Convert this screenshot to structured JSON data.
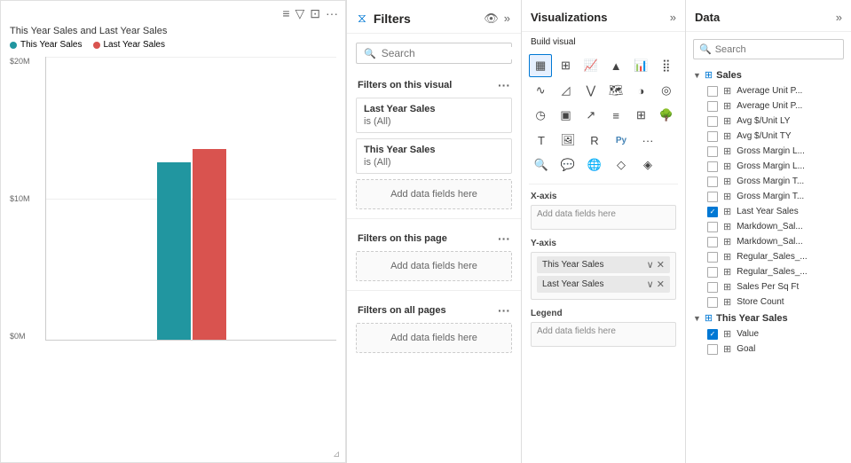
{
  "chart": {
    "title": "This Year Sales and Last Year Sales",
    "legend": [
      {
        "label": "This Year Sales",
        "color": "#2196A0"
      },
      {
        "label": "Last Year Sales",
        "color": "#d9534f"
      }
    ],
    "y_axis": [
      "$20M",
      "$10M",
      "$0M"
    ],
    "bar_this_year_height": 200,
    "bar_last_year_height": 215
  },
  "filters": {
    "title": "Filters",
    "search_placeholder": "Search",
    "filters_on_visual_label": "Filters on this visual",
    "filters_on_page_label": "Filters on this page",
    "filters_on_all_label": "Filters on all pages",
    "visual_filters": [
      {
        "title": "Last Year Sales",
        "sub": "is (All)"
      },
      {
        "title": "This Year Sales",
        "sub": "is (All)"
      }
    ],
    "add_data_fields_label": "Add data fields here"
  },
  "visualizations": {
    "title": "Visualizations",
    "build_visual_label": "Build visual",
    "x_axis_label": "X-axis",
    "y_axis_label": "Y-axis",
    "legend_label": "Legend",
    "y_axis_fields": [
      {
        "label": "This Year Sales"
      },
      {
        "label": "Last Year Sales"
      }
    ],
    "add_data_fields_label": "Add data fields here"
  },
  "data": {
    "title": "Data",
    "search_placeholder": "Search",
    "groups": [
      {
        "label": "Sales",
        "expanded": true,
        "items": [
          {
            "label": "Average Unit P...",
            "checked": false
          },
          {
            "label": "Average Unit P...",
            "checked": false
          },
          {
            "label": "Avg $/Unit LY",
            "checked": false
          },
          {
            "label": "Avg $/Unit TY",
            "checked": false
          },
          {
            "label": "Gross Margin L...",
            "checked": false
          },
          {
            "label": "Gross Margin L...",
            "checked": false
          },
          {
            "label": "Gross Margin T...",
            "checked": false
          },
          {
            "label": "Gross Margin T...",
            "checked": false
          },
          {
            "label": "Last Year Sales",
            "checked": true
          },
          {
            "label": "Markdown_Sal...",
            "checked": false
          },
          {
            "label": "Markdown_Sal...",
            "checked": false
          },
          {
            "label": "Regular_Sales_...",
            "checked": false
          },
          {
            "label": "Regular_Sales_...",
            "checked": false
          },
          {
            "label": "Sales Per Sq Ft",
            "checked": false
          },
          {
            "label": "Store Count",
            "checked": false
          }
        ]
      },
      {
        "label": "This Year Sales",
        "expanded": true,
        "items": [
          {
            "label": "Value",
            "checked": true
          },
          {
            "label": "Goal",
            "checked": false
          }
        ]
      }
    ]
  }
}
